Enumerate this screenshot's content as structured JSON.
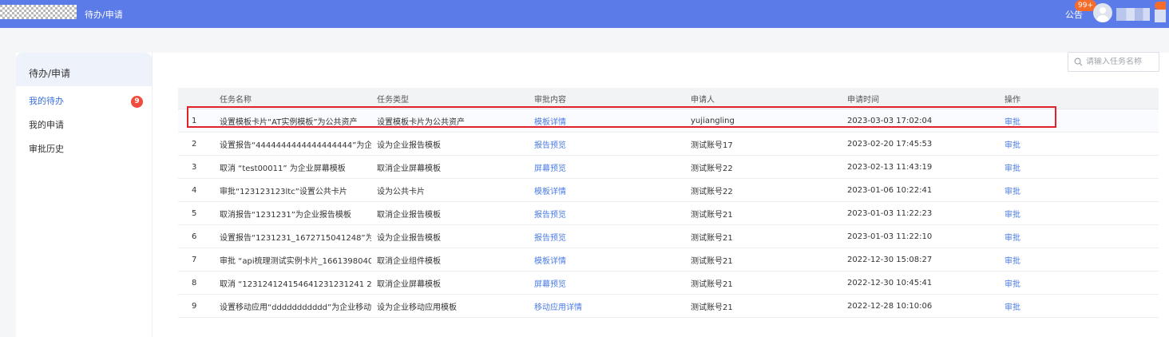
{
  "header": {
    "app_title": "待办/申请",
    "notice_label": "公告",
    "notice_badge": "99+"
  },
  "sidebar": {
    "title": "待办/申请",
    "items": [
      {
        "label": "我的待办",
        "badge": "9",
        "active": true
      },
      {
        "label": "我的申请"
      },
      {
        "label": "审批历史"
      }
    ]
  },
  "search": {
    "placeholder": "请输入任务名称",
    "value": ""
  },
  "table": {
    "columns": [
      "",
      "任务名称",
      "任务类型",
      "审批内容",
      "申请人",
      "申请时间",
      "操作"
    ],
    "rows": [
      {
        "no": "1",
        "name": "设置模板卡片“AT实例模板”为公共资产",
        "type": "设置模板卡片为公共资产",
        "content": "模板详情",
        "applicant": "yujiangling",
        "time": "2023-03-03 17:02:04",
        "action": "审批"
      },
      {
        "no": "2",
        "name": "设置报告“4444444444444444444”为企业报...",
        "type": "设为企业报告模板",
        "content": "报告预览",
        "applicant": "测试账号17",
        "time": "2023-02-20 17:45:53",
        "action": "审批"
      },
      {
        "no": "3",
        "name": "取消 “test00011” 为企业屏幕模板",
        "type": "取消企业屏幕模板",
        "content": "屏幕预览",
        "applicant": "测试账号22",
        "time": "2023-02-13 11:43:19",
        "action": "审批"
      },
      {
        "no": "4",
        "name": "审批“123123123ltc”设置公共卡片",
        "type": "设为公共卡片",
        "content": "模板详情",
        "applicant": "测试账号22",
        "time": "2023-01-06 10:22:41",
        "action": "审批"
      },
      {
        "no": "5",
        "name": "取消报告“1231231”为企业报告模板",
        "type": "取消企业报告模板",
        "content": "报告预览",
        "applicant": "测试账号21",
        "time": "2023-01-03 11:22:23",
        "action": "审批"
      },
      {
        "no": "6",
        "name": "设置报告“1231231_1672715041248”为企...",
        "type": "设为企业报告模板",
        "content": "报告预览",
        "applicant": "测试账号21",
        "time": "2023-01-03 11:22:10",
        "action": "审批"
      },
      {
        "no": "7",
        "name": "审批 “api梳理测试实例卡片_16613980404...",
        "type": "取消企业组件模板",
        "content": "模板详情",
        "applicant": "测试账号21",
        "time": "2022-12-30 15:08:27",
        "action": "审批"
      },
      {
        "no": "8",
        "name": "取消 “123124124154641231231241 2...",
        "type": "取消企业屏幕模板",
        "content": "屏幕预览",
        "applicant": "测试账号21",
        "time": "2022-12-30 10:45:41",
        "action": "审批"
      },
      {
        "no": "9",
        "name": "设置移动应用“ddddddddddd”为企业移动...",
        "type": "设为企业移动应用模板",
        "content": "移动应用详情",
        "applicant": "测试账号21",
        "time": "2022-12-28 10:10:06",
        "action": "审批"
      }
    ]
  }
}
